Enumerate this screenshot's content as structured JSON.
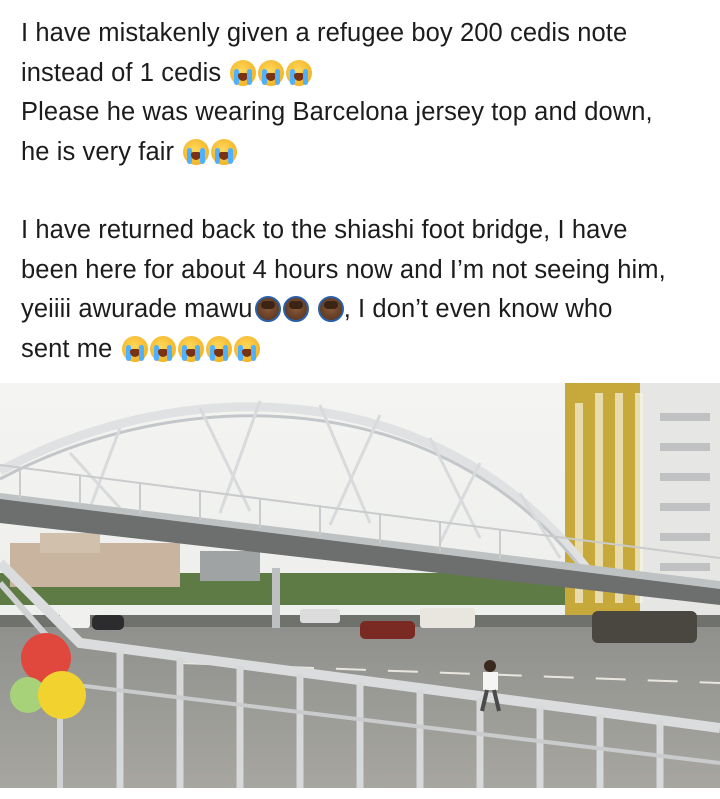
{
  "post": {
    "line1": "I have mistakenly given a refugee boy 200 cedis note",
    "line2": "instead of 1 cedis",
    "line3": "Please he was wearing Barcelona jersey top and down,",
    "line4": "he is very fair",
    "line5": "I have returned back to the shiashi foot bridge, I have",
    "line6": "been here for about 4 hours now and I’m not seeing him,",
    "line7a": "yeiiii awurade mawu",
    "line7b": ", I don’t even know who",
    "line8": "sent me"
  },
  "photo": {
    "subject": "pedestrian foot bridge over highway"
  }
}
